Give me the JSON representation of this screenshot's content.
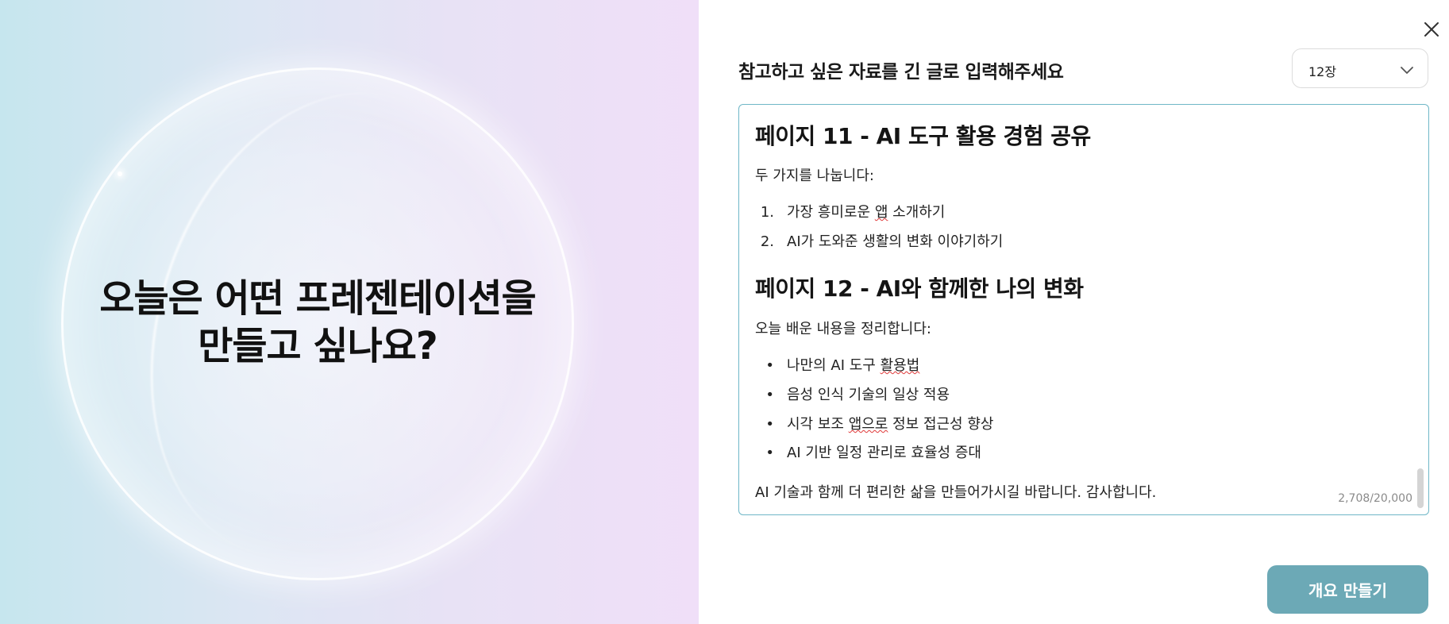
{
  "left": {
    "headline_line1": "오늘은 어떤 프레젠테이션을",
    "headline_line2": "만들고 싶나요?"
  },
  "prompt": {
    "title": "참고하고 싶은 자료를 긴 글로 입력해주세요",
    "select": {
      "value": "12장"
    }
  },
  "editor": {
    "section11": {
      "heading": "페이지 11 - AI 도구 활용 경험 공유",
      "intro": "두 가지를 나눕니다:",
      "items": [
        {
          "marker": "1.",
          "text": "가장 흥미로운 앱 소개하기"
        },
        {
          "marker": "2.",
          "text": "AI가 도와준 생활의 변화 이야기하기"
        }
      ]
    },
    "section12": {
      "heading": "페이지 12 - AI와 함께한 나의 변화",
      "intro": "오늘 배운 내용을 정리합니다:",
      "items": [
        {
          "marker": "•",
          "text": "나만의 AI 도구 활용법"
        },
        {
          "marker": "•",
          "text": "음성 인식 기술의 일상 적용"
        },
        {
          "marker": "•",
          "text": "시각 보조 앱으로 정보 접근성 향상"
        },
        {
          "marker": "•",
          "text": "AI 기반 일정 관리로 효율성 증대"
        }
      ]
    },
    "closing": "AI 기술과 함께 더 편리한 삶을 만들어가시길 바랍니다. 감사합니다.",
    "char_count": "2,708/20,000"
  },
  "actions": {
    "generate_label": "개요 만들기"
  },
  "colors": {
    "accent": "#6ca9b6",
    "editor_border": "#6fb7c7",
    "spellcheck": "#e03a3a"
  },
  "icons": {
    "close": "close-icon",
    "select_chevron": "chevron-down-icon"
  }
}
